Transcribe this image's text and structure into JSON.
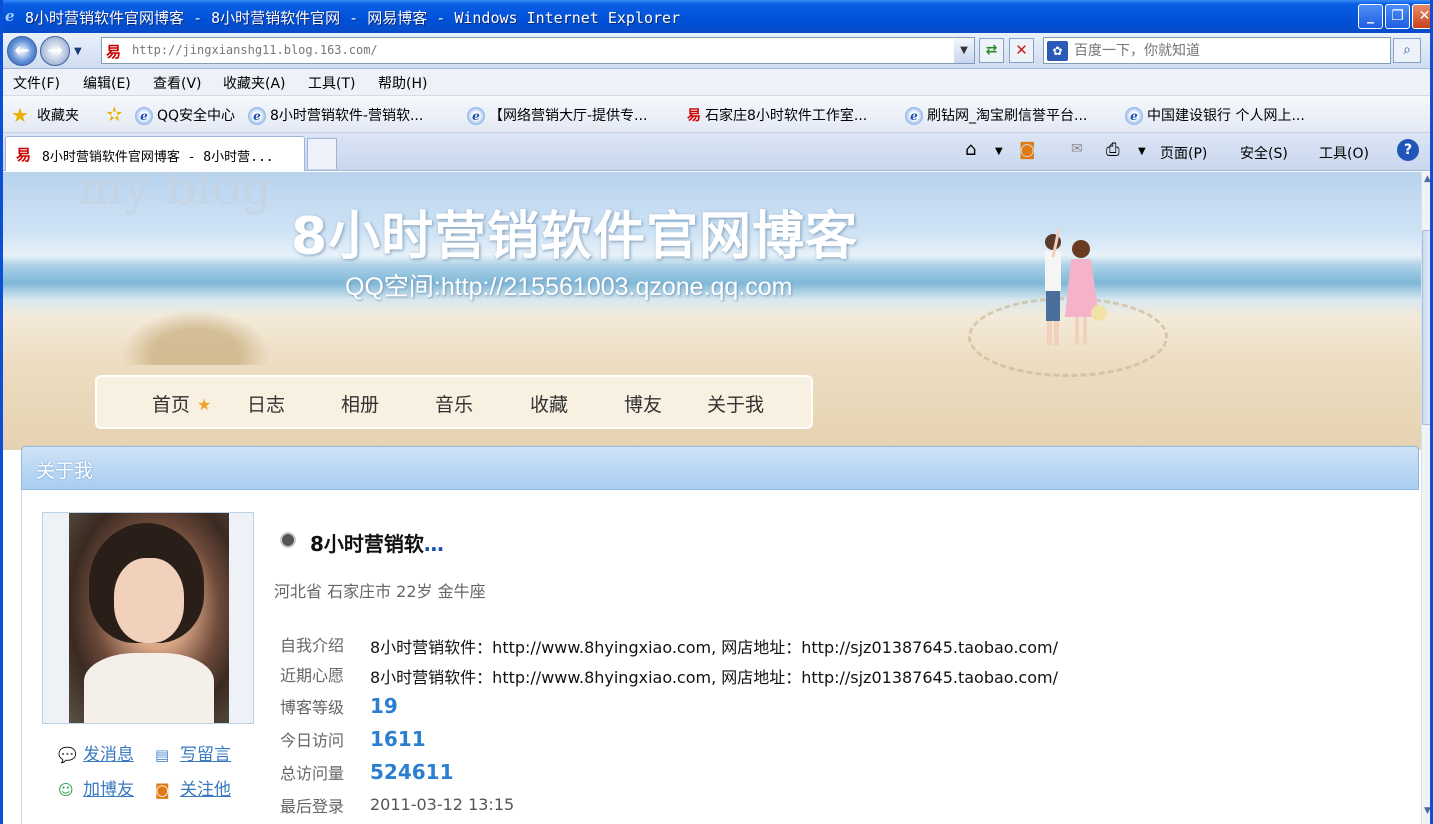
{
  "window": {
    "title": "8小时营销软件官网博客 - 8小时营销软件官网 - 网易博客 - Windows Internet Explorer",
    "min": "_",
    "max": "❐",
    "close": "✕"
  },
  "address": {
    "url": "http://jingxianshg11.blog.163.com/",
    "search_placeholder": "百度一下，你就知道"
  },
  "menu": [
    "文件(F)",
    "编辑(E)",
    "查看(V)",
    "收藏夹(A)",
    "工具(T)",
    "帮助(H)"
  ],
  "favorites": {
    "label": "收藏夹",
    "items": [
      "QQ安全中心",
      "8小时营销软件-营销软...",
      "【网络营销大厅-提供专...",
      "石家庄8小时软件工作室...",
      "刷钻网_淘宝刷信誉平台...",
      "中国建设银行 个人网上..."
    ]
  },
  "tab": {
    "active_label": "8小时营销软件官网博客 - 8小时营..."
  },
  "toolbar": {
    "page": "页面(P)",
    "safety": "安全(S)",
    "tools": "工具(O)"
  },
  "blog": {
    "ghost_text": "my blog",
    "title": "8小时营销软件官网博客",
    "subtitle": "QQ空间:http://215561003.qzone.qq.com",
    "nav": [
      "首页",
      "日志",
      "相册",
      "音乐",
      "收藏",
      "博友",
      "关于我"
    ]
  },
  "about": {
    "header": "关于我",
    "actions": [
      "发消息",
      "写留言",
      "加博友",
      "关注他"
    ],
    "name": "8小时营销软",
    "name_ellipsis": "…",
    "location": "河北省 石家庄市   22岁   金牛座",
    "fields": [
      {
        "label": "自我介绍",
        "value": "8小时营销软件：http://www.8hyingxiao.com, 网店地址：http://sjz01387645.taobao.com/"
      },
      {
        "label": "近期心愿",
        "value": "8小时营销软件：http://www.8hyingxiao.com, 网店地址：http://sjz01387645.taobao.com/"
      },
      {
        "label": "博客等级",
        "value": "19"
      },
      {
        "label": "今日访问",
        "value": "1611"
      },
      {
        "label": "总访问量",
        "value": "524611"
      },
      {
        "label": "最后登录",
        "value": "2011-03-12 13:15"
      }
    ]
  },
  "icons": {
    "ie": "e",
    "site163": "易",
    "home": "⌂",
    "rss": "◙",
    "print": "⎙",
    "help": "?",
    "star": "★"
  }
}
